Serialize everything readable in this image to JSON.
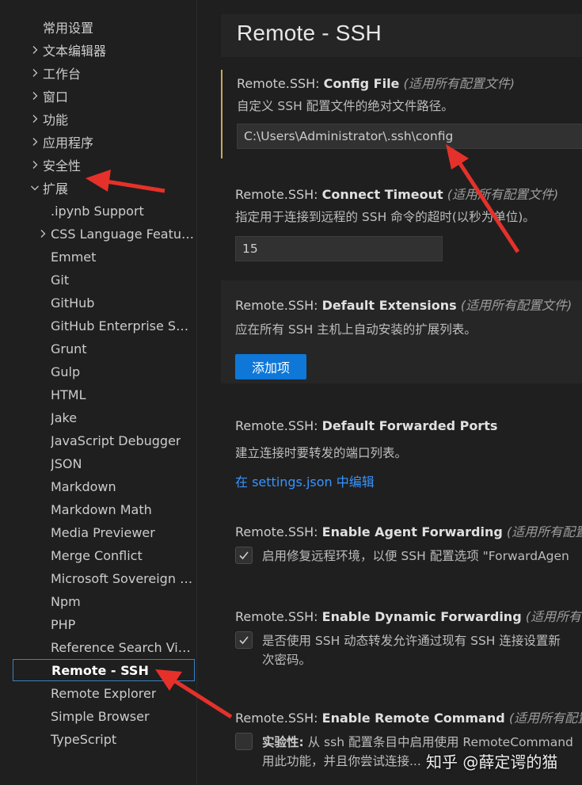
{
  "sidebar": {
    "top_items": [
      {
        "label": "常用设置",
        "chevron": false
      },
      {
        "label": "文本编辑器",
        "chevron": true
      },
      {
        "label": "工作台",
        "chevron": true
      },
      {
        "label": "窗口",
        "chevron": true
      },
      {
        "label": "功能",
        "chevron": true
      },
      {
        "label": "应用程序",
        "chevron": true
      },
      {
        "label": "安全性",
        "chevron": true
      },
      {
        "label": "扩展",
        "chevron": "open"
      }
    ],
    "extension_items": [
      {
        "label": ".ipynb Support",
        "chevron": false
      },
      {
        "label": "CSS Language Features",
        "chevron": true
      },
      {
        "label": "Emmet",
        "chevron": false
      },
      {
        "label": "Git",
        "chevron": false
      },
      {
        "label": "GitHub",
        "chevron": false
      },
      {
        "label": "GitHub Enterprise Ser...",
        "chevron": false
      },
      {
        "label": "Grunt",
        "chevron": false
      },
      {
        "label": "Gulp",
        "chevron": false
      },
      {
        "label": "HTML",
        "chevron": false
      },
      {
        "label": "Jake",
        "chevron": false
      },
      {
        "label": "JavaScript Debugger",
        "chevron": false
      },
      {
        "label": "JSON",
        "chevron": false
      },
      {
        "label": "Markdown",
        "chevron": false
      },
      {
        "label": "Markdown Math",
        "chevron": false
      },
      {
        "label": "Media Previewer",
        "chevron": false
      },
      {
        "label": "Merge Conflict",
        "chevron": false
      },
      {
        "label": "Microsoft Sovereign C...",
        "chevron": false
      },
      {
        "label": "Npm",
        "chevron": false
      },
      {
        "label": "PHP",
        "chevron": false
      },
      {
        "label": "Reference Search View",
        "chevron": false
      },
      {
        "label": "Remote - SSH",
        "chevron": false,
        "selected": true
      },
      {
        "label": "Remote Explorer",
        "chevron": false
      },
      {
        "label": "Simple Browser",
        "chevron": false
      },
      {
        "label": "TypeScript",
        "chevron": false
      }
    ]
  },
  "main": {
    "title": "Remote - SSH",
    "settings": {
      "config_file": {
        "prefix": "Remote.SSH: ",
        "name": "Config File",
        "scope": "(适用所有配置文件)",
        "description": "自定义 SSH 配置文件的绝对文件路径。",
        "value": "C:\\Users\\Administrator\\.ssh\\config"
      },
      "connect_timeout": {
        "prefix": "Remote.SSH: ",
        "name": "Connect Timeout",
        "scope": "(适用所有配置文件)",
        "description": "指定用于连接到远程的 SSH 命令的超时(以秒为单位)。",
        "value": "15"
      },
      "default_extensions": {
        "prefix": "Remote.SSH: ",
        "name": "Default Extensions",
        "scope": "(适用所有配置文件)",
        "description": "应在所有 SSH 主机上自动安装的扩展列表。",
        "button": "添加项"
      },
      "default_forwarded_ports": {
        "prefix": "Remote.SSH: ",
        "name": "Default Forwarded Ports",
        "description": "建立连接时要转发的端口列表。",
        "link": "在 settings.json 中编辑"
      },
      "enable_agent_forwarding": {
        "prefix": "Remote.SSH: ",
        "name": "Enable Agent Forwarding",
        "scope": "(适用所有配置文",
        "checked": true,
        "label": "启用修复远程环境，以便 SSH 配置选项 \"ForwardAgen"
      },
      "enable_dynamic_forwarding": {
        "prefix": "Remote.SSH: ",
        "name": "Enable Dynamic Forwarding",
        "scope": "(适用所有配置",
        "checked": true,
        "label_line1": "是否使用 SSH 动态转发允许通过现有 SSH 连接设置新",
        "label_line2": "次密码。"
      },
      "enable_remote_command": {
        "prefix": "Remote.SSH: ",
        "name": "Enable Remote Command",
        "scope": "(适用所有配置文",
        "checked": false,
        "label_bold": "实验性:",
        "label_line1": " 从 ssh 配置条目中启用使用 RemoteCommand",
        "label_line2": "用此功能，并且你尝试连接..."
      }
    }
  },
  "watermark": "知乎 @薛定谔的猫",
  "colors": {
    "background": "#1f1f1f",
    "accent_blue": "#0e77d8",
    "link_blue": "#3794ff",
    "focus_border": "#c7a75f",
    "arrow_red": "#e5312a"
  }
}
